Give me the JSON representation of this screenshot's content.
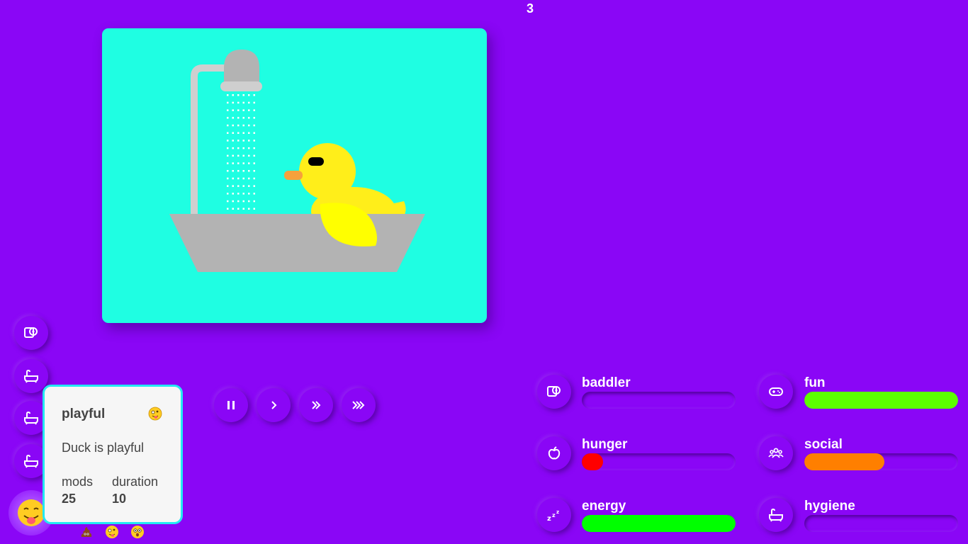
{
  "header": {
    "counter": "3"
  },
  "scene": {
    "background": "#1ffee2",
    "objects": [
      "shower",
      "bathtub",
      "duck"
    ]
  },
  "sidebar": {
    "buttons": [
      {
        "icon": "toilet-paper-icon"
      },
      {
        "icon": "bathtub-icon"
      },
      {
        "icon": "bathtub-icon"
      },
      {
        "icon": "bathtub-icon"
      }
    ]
  },
  "status_popup": {
    "title": "playful",
    "emoji": "zany-face-icon",
    "description": "Duck is playful",
    "mods_label": "mods",
    "mods_value": "25",
    "duration_label": "duration",
    "duration_value": "10"
  },
  "mood_emojis": [
    "poop-icon",
    "zany-face-icon",
    "astonished-face-icon"
  ],
  "playback": {
    "buttons": [
      {
        "icon": "pause-icon"
      },
      {
        "icon": "play-speed-1-icon"
      },
      {
        "icon": "play-speed-2-icon"
      },
      {
        "icon": "play-speed-3-icon"
      }
    ]
  },
  "stats": [
    {
      "label": "baddler",
      "icon": "toilet-paper-icon",
      "value": 0.0,
      "color": "#8a06f6"
    },
    {
      "label": "fun",
      "icon": "gamepad-icon",
      "value": 1.0,
      "color": "#5cff00"
    },
    {
      "label": "hunger",
      "icon": "apple-icon",
      "value": 0.14,
      "color": "#ff0000"
    },
    {
      "label": "social",
      "icon": "people-icon",
      "value": 0.52,
      "color": "#ff7f00"
    },
    {
      "label": "energy",
      "icon": "sleep-zzz-icon",
      "value": 1.0,
      "color": "#00ff00"
    },
    {
      "label": "hygiene",
      "icon": "bathtub-icon",
      "value": 0.0,
      "color": "#8a06f6"
    }
  ]
}
